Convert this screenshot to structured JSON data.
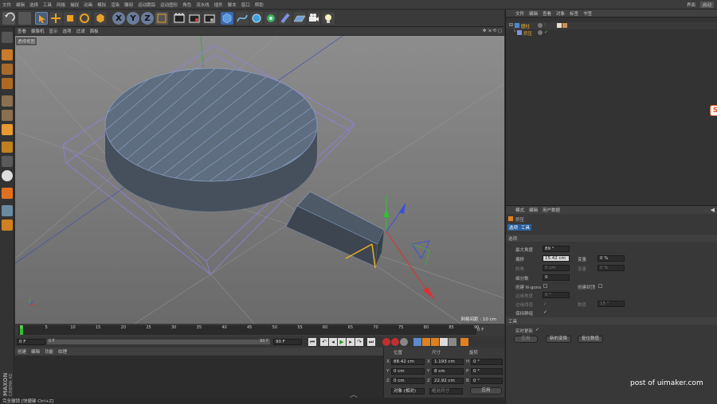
{
  "menubar": {
    "items": [
      "文件",
      "编辑",
      "选择",
      "工具",
      "网格",
      "捕捉",
      "动画",
      "模拟",
      "渲染",
      "雕刻",
      "运动跟踪",
      "运动图形",
      "角色",
      "流水线",
      "插件",
      "脚本",
      "窗口",
      "帮助"
    ],
    "layout_label": "界面",
    "layout_value": "启动"
  },
  "toolbar": {
    "icons": [
      "undo-icon",
      "select-icon",
      "move-icon",
      "scale-icon",
      "rotate-icon",
      "cube-icon",
      "x-axis-icon",
      "y-axis-icon",
      "z-axis-icon",
      "coord-system-icon",
      "render-view-icon",
      "render-picture-icon",
      "render-settings-icon",
      "primitive-cube-icon",
      "spline-icon",
      "nurbs-icon",
      "array-icon",
      "deformer-icon",
      "floor-icon",
      "camera-icon",
      "light-icon"
    ],
    "axis_labels": [
      "X",
      "Y",
      "Z"
    ]
  },
  "viewport": {
    "menu": [
      "查看",
      "摄像机",
      "显示",
      "选项",
      "过滤",
      "面板"
    ],
    "label": "透视视图",
    "grid_info": "网格间距 : 10 cm"
  },
  "timeline": {
    "ticks": [
      "0",
      "5",
      "10",
      "15",
      "20",
      "25",
      "30",
      "35",
      "40",
      "45",
      "50",
      "55",
      "60",
      "65",
      "70",
      "75",
      "80",
      "85",
      "90"
    ],
    "frame_right": "0 F"
  },
  "playbar": {
    "start": "0 F",
    "current": "0 F",
    "end_marker": "90 F",
    "end": "90 F"
  },
  "material_manager": {
    "menu": [
      "创建",
      "编辑",
      "功能",
      "纹理"
    ]
  },
  "coordinates": {
    "headers": [
      "位置",
      "尺寸",
      "旋转"
    ],
    "rows": [
      {
        "axis": "X",
        "pos": "88.42 cm",
        "size_axis": "X",
        "size": "1.193 cm",
        "rot_axis": "H",
        "rot": "0 °"
      },
      {
        "axis": "Y",
        "pos": "0 cm",
        "size_axis": "Y",
        "size": "8 cm",
        "rot_axis": "P",
        "rot": "0 °"
      },
      {
        "axis": "Z",
        "pos": "0 cm",
        "size_axis": "Z",
        "size": "22.92 cm",
        "rot_axis": "B",
        "rot": "0 °"
      }
    ],
    "mode": "对象 (相对)",
    "size_mode": "绝对尺寸",
    "apply": "应用"
  },
  "object_manager": {
    "menu": [
      "文件",
      "编辑",
      "查看",
      "对象",
      "标签",
      "书签"
    ],
    "objects": [
      {
        "name": "圆柱",
        "child": false
      },
      {
        "name": "挤压",
        "child": true
      }
    ]
  },
  "attribute_manager": {
    "menu": [
      "模式",
      "编辑",
      "用户数据"
    ],
    "title": "挤压",
    "tabs": [
      "选项",
      "工具"
    ],
    "section_options": "选项",
    "fields": {
      "max_angle_label": "最大角度",
      "max_angle": "89 °",
      "offset_label": "偏移",
      "offset": "15.42 cm",
      "variance_label": "变量",
      "variance": "0 %",
      "bevel_label": "斜角",
      "bevel": "0 cm",
      "variance2_label": "变量",
      "variance2": "0 %",
      "subdiv_label": "细分数",
      "subdiv": "0",
      "ngons_label": "创建 N-gons",
      "caps_label": "创建封顶",
      "edge_angle_label": "边缘角度",
      "edge_angle": "0 °",
      "edge_phong_label": "边缘阈值",
      "count_label": "数值",
      "count": "15 °",
      "keep_groups_label": "保持群组"
    },
    "section_tool": "工具",
    "realtime_label": "实时更新",
    "buttons": [
      "应用",
      "新的变换",
      "复位数值"
    ]
  },
  "status": {
    "text": "完全撤销 [快捷键 Ctrl+Z]"
  },
  "brand": {
    "maxon_line1": "MAXON",
    "maxon_line2": "CINEMA 4D",
    "watermark": "post of uimaker.com",
    "badge": "S"
  },
  "colors": {
    "accent_orange": "#f0a020",
    "selection_blue": "#2a5f9e",
    "axis_x": "#e03030",
    "axis_y": "#30c030",
    "axis_z": "#3050e0"
  }
}
